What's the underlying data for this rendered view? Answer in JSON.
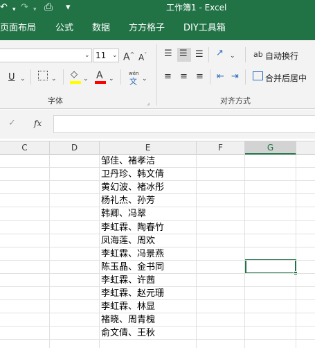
{
  "window": {
    "title": "工作簿1  -  Excel"
  },
  "qat": {
    "undo": "↶",
    "redo": "↷",
    "print_preview": "⎙",
    "customize": "▾"
  },
  "tabs": [
    "页面布局",
    "公式",
    "数据",
    "方方格子",
    "DIY工具箱"
  ],
  "font_group": {
    "label": "字体",
    "font_size": "11",
    "increase_font": "A",
    "decrease_font": "A",
    "underline": "U",
    "font_color": "A",
    "phonetic_top": "wén",
    "phonetic_bottom": "文",
    "highlight_color": "#ffff00",
    "font_color_swatch": "#ff0000"
  },
  "align_group": {
    "label": "对齐方式",
    "wrap_text": "自动换行",
    "merge_center": "合并后居中",
    "wrap_icon": "ab"
  },
  "formula_bar": {
    "cancel": "✓",
    "fx": "fx",
    "value": ""
  },
  "columns": [
    "C",
    "D",
    "E",
    "F",
    "G"
  ],
  "selected_column": "G",
  "cells": [
    "邹佳、褚孝洁",
    "卫丹珍、韩文倩",
    "黄幻波、褚冰彤",
    "杨礼杰、孙芳",
    "韩卿、冯翠",
    "李虹霖、陶春竹",
    "凤海莲、周欢",
    "李虹霖、冯景燕",
    "陈玉晶、金书同",
    "李虹霖、许茜",
    "李虹霖、赵元珊",
    "李虹霖、林显",
    "褚晓、周青槐",
    "俞文倩、王秋"
  ],
  "colors": {
    "brand": "#217346",
    "ribbon": "#f3f3f3"
  }
}
